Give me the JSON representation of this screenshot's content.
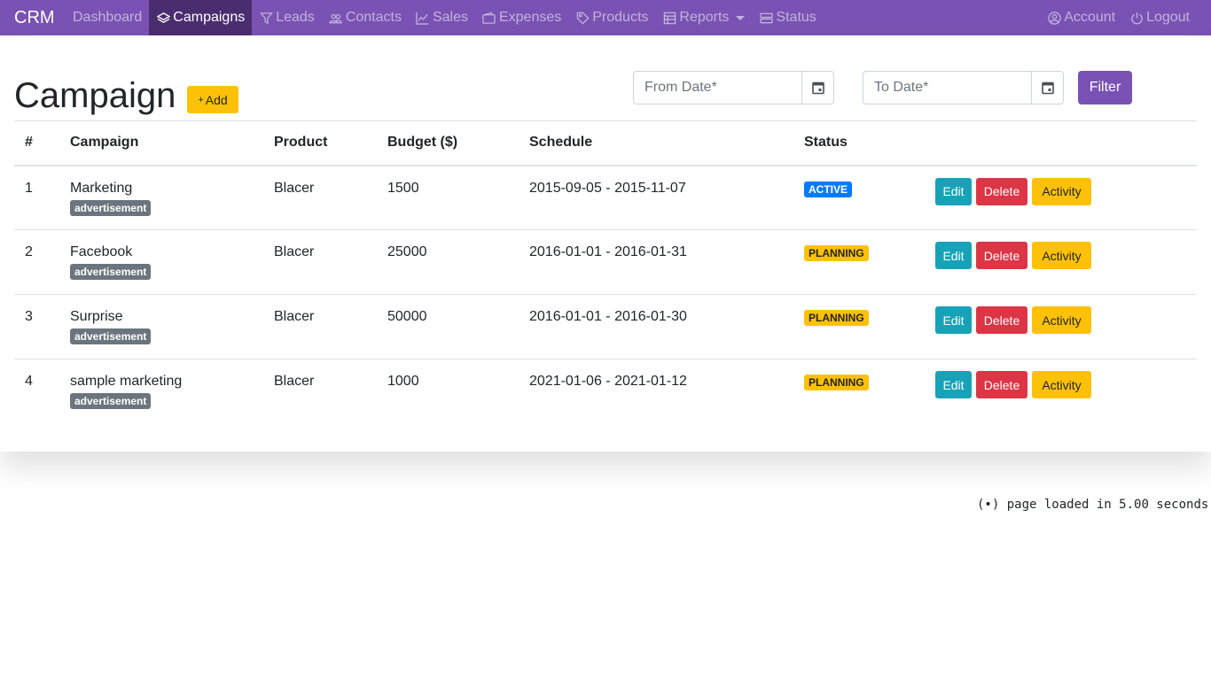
{
  "navbar": {
    "brand": "CRM",
    "left_items": [
      {
        "label": "Dashboard",
        "icon": "none",
        "active": false
      },
      {
        "label": "Campaigns",
        "icon": "layers-icon",
        "active": true
      },
      {
        "label": "Leads",
        "icon": "filter-icon",
        "active": false
      },
      {
        "label": "Contacts",
        "icon": "people-icon",
        "active": false
      },
      {
        "label": "Sales",
        "icon": "graph-up-icon",
        "active": false
      },
      {
        "label": "Expenses",
        "icon": "wallet-icon",
        "active": false
      },
      {
        "label": "Products",
        "icon": "tag-icon",
        "active": false
      },
      {
        "label": "Reports",
        "icon": "table-icon",
        "active": false,
        "dropdown": true
      },
      {
        "label": "Status",
        "icon": "server-icon",
        "active": false
      }
    ],
    "right_items": [
      {
        "label": "Account",
        "icon": "person-circle-icon"
      },
      {
        "label": "Logout",
        "icon": "power-icon"
      }
    ]
  },
  "page": {
    "title": "Campaign",
    "add_label": "Add",
    "add_icon": "plus-icon"
  },
  "filters": {
    "from_placeholder": "From Date*",
    "to_placeholder": "To Date*",
    "filter_label": "Filter"
  },
  "table": {
    "headers": [
      "#",
      "Campaign",
      "Product",
      "Budget ($)",
      "Schedule",
      "Status",
      ""
    ],
    "rows": [
      {
        "num": "1",
        "campaign": "Marketing",
        "tag": "advertisement",
        "product": "Blacer",
        "budget": "1500",
        "schedule": "2015-09-05 - 2015-11-07",
        "status": "ACTIVE"
      },
      {
        "num": "2",
        "campaign": "Facebook",
        "tag": "advertisement",
        "product": "Blacer",
        "budget": "25000",
        "schedule": "2016-01-01 - 2016-01-31",
        "status": "PLANNING"
      },
      {
        "num": "3",
        "campaign": "Surprise",
        "tag": "advertisement",
        "product": "Blacer",
        "budget": "50000",
        "schedule": "2016-01-01 - 2016-01-30",
        "status": "PLANNING"
      },
      {
        "num": "4",
        "campaign": "sample marketing",
        "tag": "advertisement",
        "product": "Blacer",
        "budget": "1000",
        "schedule": "2021-01-06 - 2021-01-12",
        "status": "PLANNING"
      }
    ],
    "actions": {
      "edit": "Edit",
      "delete": "Delete",
      "activity": "Activity"
    }
  },
  "footer": {
    "loaded_icon": "broadcast-icon",
    "loaded_text": "page loaded in 5.00 seconds"
  },
  "colors": {
    "navbar": "#7952b3",
    "nav_active": "#4a2d6f",
    "warning": "#ffc107",
    "info": "#17a2b8",
    "danger": "#dc3545",
    "primary": "#007bff",
    "secondary": "#6c757d"
  }
}
